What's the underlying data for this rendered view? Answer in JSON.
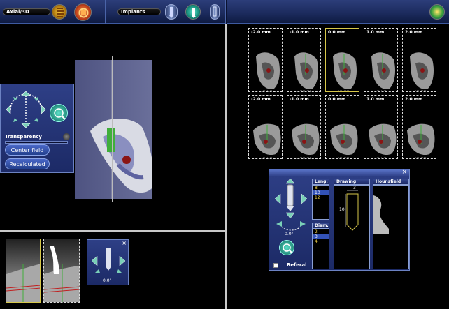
{
  "toolbar": {
    "view_label": "Axial/3D",
    "implants_label": "Implants",
    "icons": [
      "spine-icon",
      "ct-volume-icon",
      "implant-plan-icon",
      "implant-selected-icon",
      "implant-outline-icon",
      "logo-globe-icon"
    ]
  },
  "left_panel": {
    "transparency_label": "Transparency",
    "center_field_label": "Center field",
    "recalculated_label": "Recalculated"
  },
  "cross_sections": {
    "row1": [
      "-2.0 mm",
      "-1.0 mm",
      "0.0 mm",
      "1.0 mm",
      "2.0 mm"
    ],
    "row2": [
      "-2.0 mm",
      "-1.0 mm",
      "0.0 mm",
      "1.0 mm",
      "2.0 mm"
    ],
    "active_index": 2
  },
  "mini_rotate": {
    "angle": "0.0°"
  },
  "implant_dialog": {
    "close": "×",
    "length_header": "Leng.",
    "lengths": [
      "8",
      "10",
      "12"
    ],
    "selected_length": "10",
    "diameter_header": "Diam.",
    "diameters": [
      "2",
      "3",
      "4"
    ],
    "selected_diameter": "3",
    "drawing_header": "Drawing",
    "drawing_width": "3",
    "drawing_length": "10",
    "hounsfield_header": "Hounsfield unit",
    "angle": "0.0°",
    "referal_label": "Referal"
  },
  "colors": {
    "toolbar_blue": "#1b2a5c",
    "panel_blue": "#2e3f86",
    "active_thumb_border": "#d8c84a",
    "selected_item": "#3352b8",
    "implant_outline": "#d8c84a"
  }
}
